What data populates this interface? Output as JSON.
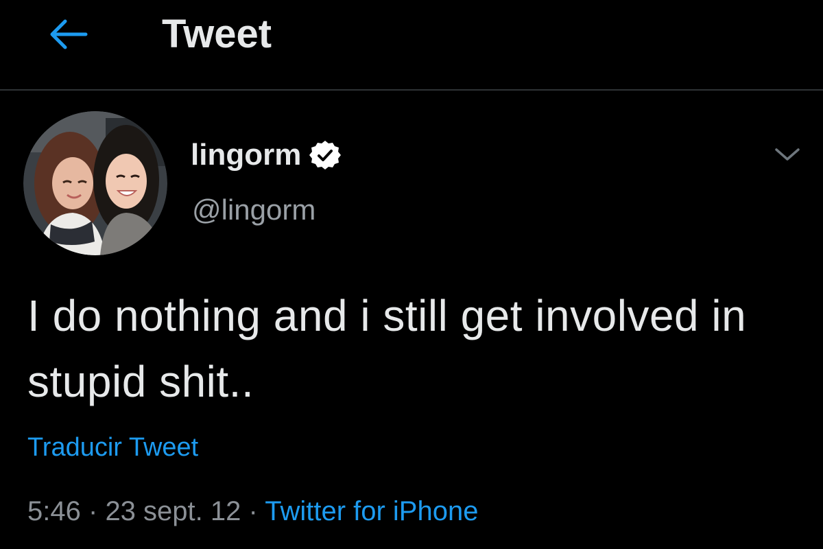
{
  "header": {
    "title": "Tweet",
    "back_icon": "arrow-left-icon",
    "accent": "#1d9bf0"
  },
  "author": {
    "display_name": "lingorm",
    "handle": "@lingorm",
    "verified": true,
    "verified_icon": "verified-badge-icon",
    "avatar_icon": "profile-photo",
    "more_icon": "chevron-down-icon"
  },
  "tweet": {
    "text": "I do nothing and i still get involved in stupid shit..",
    "translate_label": "Traducir Tweet",
    "time": "5:46",
    "separator": "·",
    "date": "23 sept. 12",
    "source": "Twitter for iPhone"
  },
  "colors": {
    "background": "#000000",
    "text": "#e7e9ea",
    "secondary": "#8b9096",
    "link": "#1d9bf0",
    "divider": "#2f3336"
  }
}
